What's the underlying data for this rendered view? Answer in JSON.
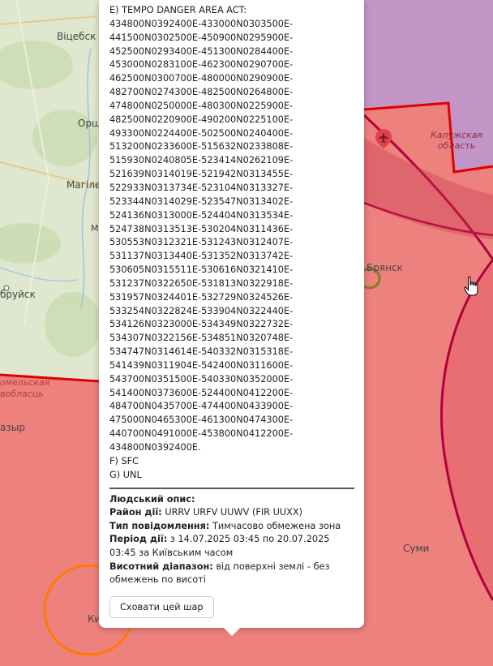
{
  "map": {
    "labels": {
      "vitebsk": "Віцебск",
      "orsha": "Орш",
      "mogilev": "Магіле",
      "bryansk": "Брянск",
      "sumy": "Суми",
      "kaluga_region": "Калужская\nобласть",
      "gomel_region": "омельская\nвобласць",
      "zhlobin": "бруйск",
      "mazyr": "азыр",
      "kyiv": "Ки",
      "m_letter": "М"
    },
    "colors": {
      "zone_fill": "#f06f6f",
      "zone_border": "#e00000",
      "kaluga_fill": "#c88bc6",
      "circle_border": "#b0003f",
      "orange_circle": "#ff7a00",
      "olive_circle": "#8a7b23"
    }
  },
  "popup": {
    "notam_lines": [
      "E) TEMPO DANGER AREA ACT:",
      "434800N0392400E-433000N0303500E-",
      "441500N0302500E-450900N0295900E-",
      "452500N0293400E-451300N0284400E-",
      "453000N0283100E-462300N0290700E-",
      "462500N0300700E-480000N0290900E-",
      "482700N0274300E-482500N0264800E-",
      "474800N0250000E-480300N0225900E-",
      "482500N0220900E-490200N0225100E-",
      "493300N0224400E-502500N0240400E-",
      "513200N0233600E-515632N0233808E-",
      "515930N0240805E-523414N0262109E-",
      "521639N0314019E-521942N0313455E-",
      "522933N0313734E-523104N0313327E-",
      "523344N0314029E-523547N0313402E-",
      "524136N0313000E-524404N0313534E-",
      "524738N0313513E-530204N0311436E-",
      "530553N0312321E-531243N0312407E-",
      "531137N0313440E-531352N0313742E-",
      "530605N0315511E-530616N0321410E-",
      "531237N0322650E-531813N0322918E-",
      "531957N0324401E-532729N0324526E-",
      "533254N0322824E-533904N0322440E-",
      "534126N0323000E-534349N0322732E-",
      "534307N0322156E-534851N0320748E-",
      "534747N0314614E-540332N0315318E-",
      "541439N0311904E-542400N0311600E-",
      "543700N0351500E-540330N0352000E-",
      "541400N0373600E-524400N0412200E-",
      "484700N0435700E-474400N0433900E-",
      "475000N0465300E-461300N0474300E-",
      "440700N0491000E-453800N0412200E-",
      "434800N0392400E.",
      "F) SFC",
      "G) UNL"
    ],
    "human_title": "Людський опис:",
    "area_label": "Район дії:",
    "area_value": "URRV URFV UUWV (FIR UUXX)",
    "type_label": "Тип повідомлення:",
    "type_value": "Тимчасово обмежена зона",
    "period_label": "Період дії:",
    "period_value": "з 14.07.2025 03:45 по 20.07.2025 03:45 за Київським часом",
    "altitude_label": "Висотний діапазон:",
    "altitude_value": "від поверхні землі - без обмежень по висоті",
    "hide_button": "Сховати цей шар"
  }
}
